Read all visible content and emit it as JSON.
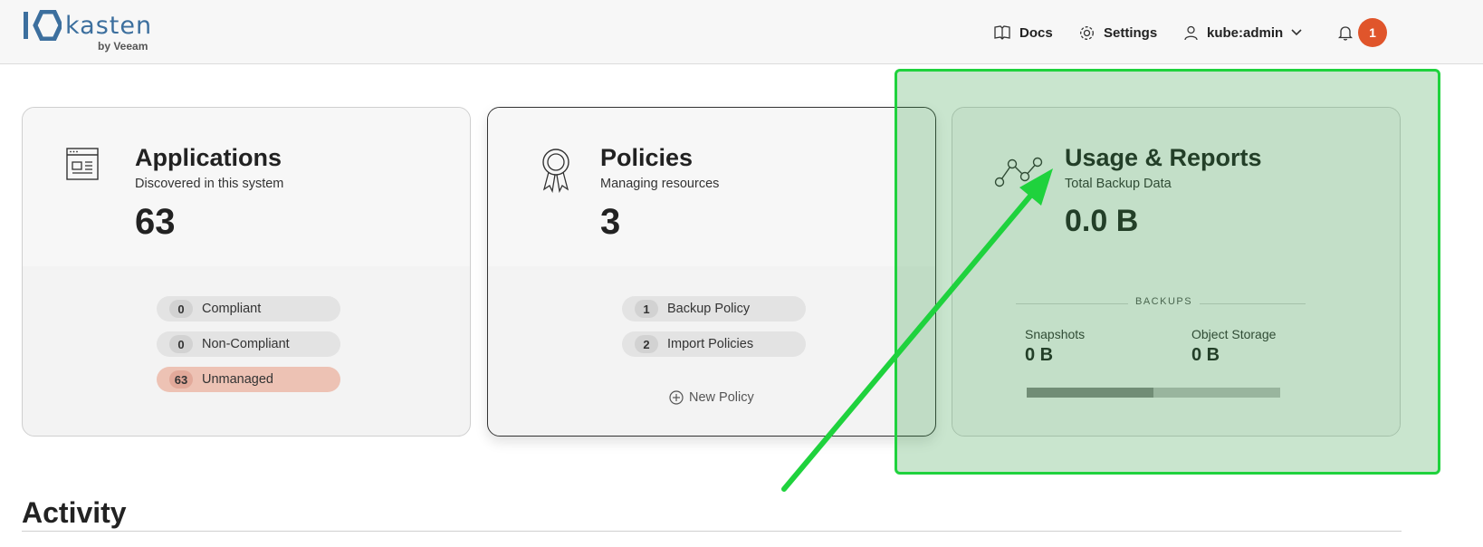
{
  "header": {
    "logo_word": "kasten",
    "logo_sub": "by Veeam",
    "docs_label": "Docs",
    "settings_label": "Settings",
    "user_label": "kube:admin",
    "notification_count": "1"
  },
  "cards": {
    "applications": {
      "title": "Applications",
      "subtitle": "Discovered in this system",
      "count": "63",
      "pills": [
        {
          "count": "0",
          "label": "Compliant"
        },
        {
          "count": "0",
          "label": "Non-Compliant"
        },
        {
          "count": "63",
          "label": "Unmanaged"
        }
      ]
    },
    "policies": {
      "title": "Policies",
      "subtitle": "Managing resources",
      "count": "3",
      "pills": [
        {
          "count": "1",
          "label": "Backup Policy"
        },
        {
          "count": "2",
          "label": "Import Policies"
        }
      ],
      "new_policy_label": "New Policy"
    },
    "usage": {
      "title": "Usage & Reports",
      "subtitle": "Total Backup Data",
      "total": "0.0 B",
      "section_label": "BACKUPS",
      "snapshots_label": "Snapshots",
      "snapshots_value": "0 B",
      "object_storage_label": "Object Storage",
      "object_storage_value": "0 B",
      "bar_fill_fraction": 0.5
    }
  },
  "activity": {
    "title": "Activity"
  },
  "colors": {
    "accent_orange": "#e0552b",
    "highlight_green": "#1fd23d",
    "brand_blue": "#3c6f9e"
  }
}
